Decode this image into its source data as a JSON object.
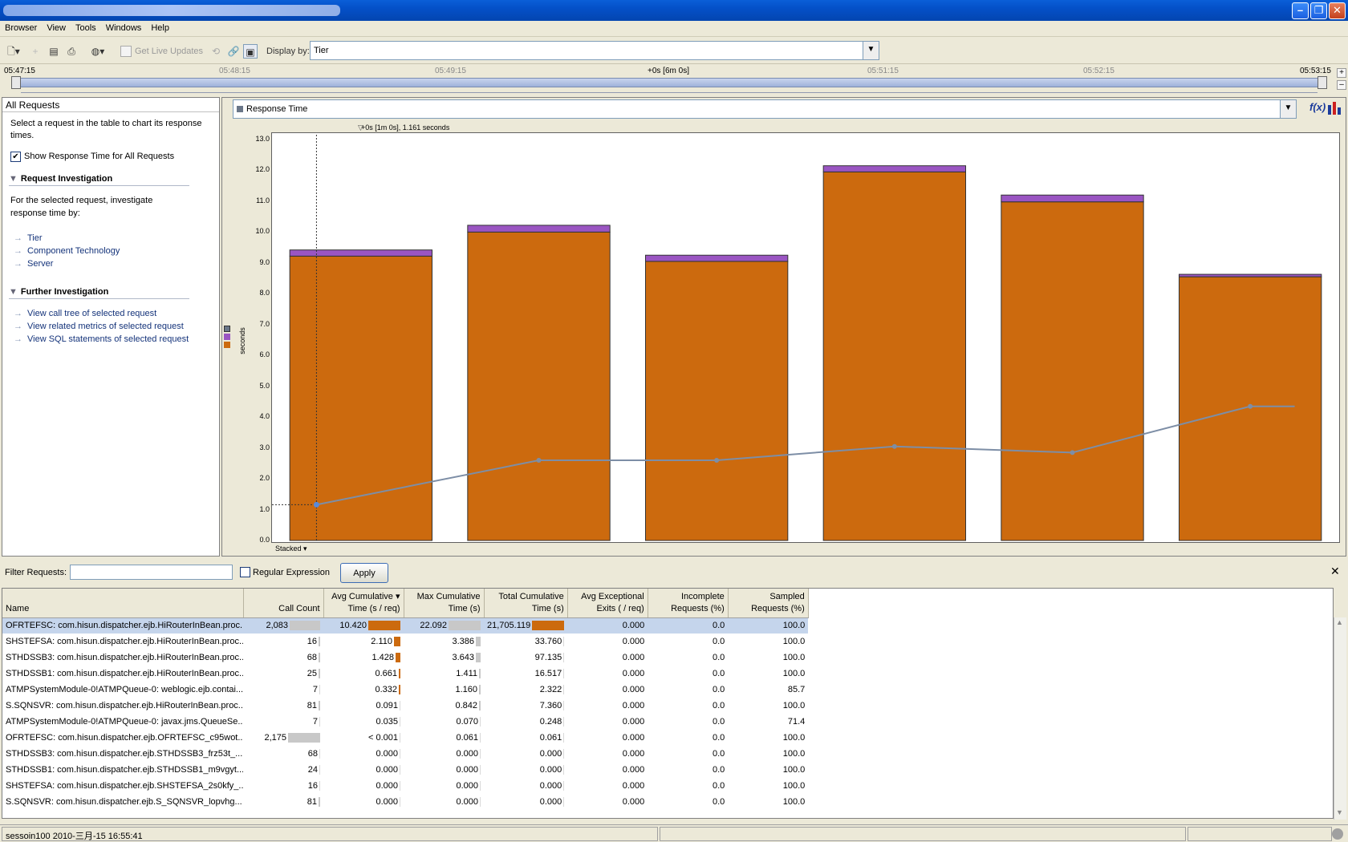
{
  "menu": [
    "Browser",
    "View",
    "Tools",
    "Windows",
    "Help"
  ],
  "toolbar": {
    "live_updates": "Get Live Updates",
    "display_by_label": "Display by:",
    "display_by_value": "Tier"
  },
  "timeline": {
    "ticks": [
      "05:47:15",
      "05:48:15",
      "05:49:15",
      "+0s [6m 0s]",
      "05:51:15",
      "05:52:15",
      "05:53:15"
    ]
  },
  "left_panel": {
    "title": "All Requests",
    "hint": "Select a request in the table to chart its response times.",
    "show_all_label": "Show Response Time for All Requests",
    "request_investigation": {
      "title": "Request Investigation",
      "desc": "For the selected request, investigate response time by:",
      "links": [
        "Tier",
        "Component Technology",
        "Server"
      ]
    },
    "further_investigation": {
      "title": "Further Investigation",
      "links": [
        "View call tree of selected request",
        "View related metrics of selected request",
        "View SQL statements of selected request"
      ]
    }
  },
  "chart_panel": {
    "metric": "Response Time",
    "marker_label": "+0s [1m 0s], 1.161 seconds",
    "stacked_label": "Stacked",
    "ylabel": "seconds"
  },
  "chart_data": {
    "type": "bar",
    "stacked": true,
    "ylim": [
      0,
      13
    ],
    "yticks": [
      "0.0",
      "1.0",
      "2.0",
      "3.0",
      "4.0",
      "5.0",
      "6.0",
      "7.0",
      "8.0",
      "9.0",
      "10.0",
      "11.0",
      "12.0",
      "13.0"
    ],
    "series": [
      {
        "color": "#cc6a0e",
        "values": [
          9.22,
          10.0,
          9.05,
          11.95,
          10.98,
          8.55
        ]
      },
      {
        "color": "#9a55c2",
        "values": [
          0.2,
          0.22,
          0.2,
          0.2,
          0.22,
          0.08
        ]
      },
      {
        "type": "line",
        "color": "#7d8ea6",
        "x": [
          0.25,
          1.5,
          2.5,
          3.5,
          4.5,
          5.5,
          5.75
        ],
        "values": [
          1.161,
          2.6,
          2.6,
          3.05,
          2.85,
          4.35,
          4.35
        ]
      }
    ],
    "marker_x": 0.25,
    "colors": {
      "bar": "#cc6a0e",
      "cap": "#9a55c2",
      "line": "#7d8ea6",
      "legend_gray": "#6a7688"
    }
  },
  "filter": {
    "label": "Filter Requests:",
    "value": "",
    "regex_label": "Regular Expression",
    "apply_label": "Apply"
  },
  "table": {
    "columns": [
      {
        "l1": "",
        "l2": "Name"
      },
      {
        "l1": "",
        "l2": "Call Count"
      },
      {
        "l1": "Avg Cumulative",
        "l2": "Time (s / req)"
      },
      {
        "l1": "Max Cumulative",
        "l2": "Time (s)"
      },
      {
        "l1": "Total Cumulative",
        "l2": "Time (s)"
      },
      {
        "l1": "Avg Exceptional",
        "l2": "Exits ( / req)"
      },
      {
        "l1": "Incomplete",
        "l2": "Requests (%)"
      },
      {
        "l1": "Sampled",
        "l2": "Requests (%)"
      }
    ],
    "rows": [
      {
        "name": "OFRTEFSC: com.hisun.dispatcher.ejb.HiRouterInBean.proc...",
        "count": "2,083",
        "avg": "10.420",
        "max": "22.092",
        "total": "21,705.119",
        "exc": "0.000",
        "inc": "0.0",
        "samp": "100.0",
        "count_bar": 0.96,
        "avg_bar": 1.0,
        "max_bar": 1.0,
        "total_bar": 1.0
      },
      {
        "name": "SHSTEFSA: com.hisun.dispatcher.ejb.HiRouterInBean.proc...",
        "count": "16",
        "avg": "2.110",
        "max": "3.386",
        "total": "33.760",
        "exc": "0.000",
        "inc": "0.0",
        "samp": "100.0",
        "count_bar": 0.01,
        "avg_bar": 0.2,
        "max_bar": 0.15,
        "total_bar": 0
      },
      {
        "name": "STHDSSB3: com.hisun.dispatcher.ejb.HiRouterInBean.proc...",
        "count": "68",
        "avg": "1.428",
        "max": "3.643",
        "total": "97.135",
        "exc": "0.000",
        "inc": "0.0",
        "samp": "100.0",
        "count_bar": 0.03,
        "avg_bar": 0.14,
        "max_bar": 0.16,
        "total_bar": 0
      },
      {
        "name": "STHDSSB1: com.hisun.dispatcher.ejb.HiRouterInBean.proc...",
        "count": "25",
        "avg": "0.661",
        "max": "1.411",
        "total": "16.517",
        "exc": "0.000",
        "inc": "0.0",
        "samp": "100.0",
        "count_bar": 0.01,
        "avg_bar": 0.06,
        "max_bar": 0.06,
        "total_bar": 0
      },
      {
        "name": "ATMPSystemModule-0!ATMPQueue-0: weblogic.ejb.contai...",
        "count": "7",
        "avg": "0.332",
        "max": "1.160",
        "total": "2.322",
        "exc": "0.000",
        "inc": "0.0",
        "samp": "85.7",
        "count_bar": 0,
        "avg_bar": 0.03,
        "max_bar": 0.05,
        "total_bar": 0
      },
      {
        "name": "S.SQNSVR: com.hisun.dispatcher.ejb.HiRouterInBean.proc...",
        "count": "81",
        "avg": "0.091",
        "max": "0.842",
        "total": "7.360",
        "exc": "0.000",
        "inc": "0.0",
        "samp": "100.0",
        "count_bar": 0.03,
        "avg_bar": 0,
        "max_bar": 0.03,
        "total_bar": 0
      },
      {
        "name": "ATMPSystemModule-0!ATMPQueue-0: javax.jms.QueueSe...",
        "count": "7",
        "avg": "0.035",
        "max": "0.070",
        "total": "0.248",
        "exc": "0.000",
        "inc": "0.0",
        "samp": "71.4",
        "count_bar": 0,
        "avg_bar": 0,
        "max_bar": 0,
        "total_bar": 0
      },
      {
        "name": "OFRTEFSC: com.hisun.dispatcher.ejb.OFRTEFSC_c95wot...",
        "count": "2,175",
        "avg": "< 0.001",
        "max": "0.061",
        "total": "0.061",
        "exc": "0.000",
        "inc": "0.0",
        "samp": "100.0",
        "count_bar": 1.0,
        "avg_bar": 0,
        "max_bar": 0,
        "total_bar": 0
      },
      {
        "name": "STHDSSB3: com.hisun.dispatcher.ejb.STHDSSB3_frz53t_...",
        "count": "68",
        "avg": "0.000",
        "max": "0.000",
        "total": "0.000",
        "exc": "0.000",
        "inc": "0.0",
        "samp": "100.0",
        "count_bar": 0,
        "avg_bar": 0,
        "max_bar": 0,
        "total_bar": 0
      },
      {
        "name": "STHDSSB1: com.hisun.dispatcher.ejb.STHDSSB1_m9vgyt...",
        "count": "24",
        "avg": "0.000",
        "max": "0.000",
        "total": "0.000",
        "exc": "0.000",
        "inc": "0.0",
        "samp": "100.0",
        "count_bar": 0,
        "avg_bar": 0,
        "max_bar": 0,
        "total_bar": 0
      },
      {
        "name": "SHSTEFSA: com.hisun.dispatcher.ejb.SHSTEFSA_2s0kfy_...",
        "count": "16",
        "avg": "0.000",
        "max": "0.000",
        "total": "0.000",
        "exc": "0.000",
        "inc": "0.0",
        "samp": "100.0",
        "count_bar": 0,
        "avg_bar": 0,
        "max_bar": 0,
        "total_bar": 0
      },
      {
        "name": "S.SQNSVR: com.hisun.dispatcher.ejb.S_SQNSVR_lopvhg...",
        "count": "81",
        "avg": "0.000",
        "max": "0.000",
        "total": "0.000",
        "exc": "0.000",
        "inc": "0.0",
        "samp": "100.0",
        "count_bar": 0.03,
        "avg_bar": 0,
        "max_bar": 0,
        "total_bar": 0
      }
    ]
  },
  "status": {
    "text": "sessoin100 2010-三月-15 16:55:41"
  }
}
